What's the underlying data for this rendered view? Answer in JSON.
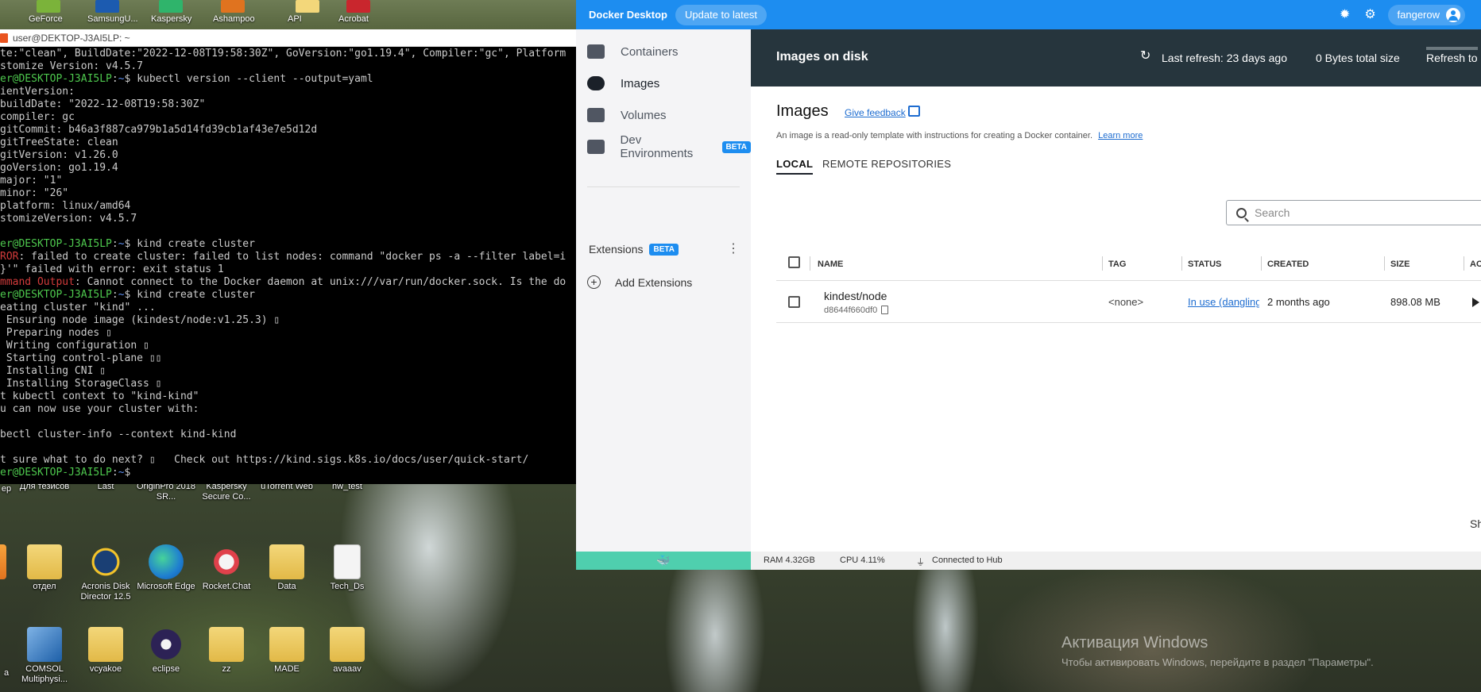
{
  "desktop": {
    "top_icons": [
      "GeForce",
      "SamsungU...",
      "Kaspersky",
      "Ashampoo",
      "API",
      "Acrobat"
    ],
    "icons_row1": [
      "Для тезисов",
      "Last",
      "OriginPro 2018 SR...",
      "Kaspersky Secure Co...",
      "uTorrent Web",
      "hw_test"
    ],
    "icons_row1_partial": "ер",
    "icons_row2": [
      "отдел",
      "Acronis Disk Director 12.5",
      "Microsoft Edge",
      "Rocket.Chat",
      "Data",
      "Tech_Ds"
    ],
    "icons_row3": [
      "COMSOL Multiphysi...",
      "vcyakoe",
      "eclipse",
      "zz",
      "MADE",
      "avaaav"
    ],
    "icons_row3_partial": "a",
    "watermark_title": "Активация Windows",
    "watermark_text": "Чтобы активировать Windows, перейдите в раздел \"Параметры\"."
  },
  "terminal": {
    "title": "user@DEKTOP-J3AI5LP: ~",
    "lines": [
      [
        {
          "t": "te:\"clean\", BuildDate:\"2022-12-08T19:58:30Z\", GoVersion:\"go1.19.4\", Compiler:\"gc\", Platform",
          "c": ""
        }
      ],
      [
        {
          "t": "stomize Version: v4.5.7",
          "c": ""
        }
      ],
      [
        {
          "t": "er@DESKTOP-J3AI5LP",
          "c": "g"
        },
        {
          "t": ":",
          "c": ""
        },
        {
          "t": "~",
          "c": "b"
        },
        {
          "t": "$ kubectl version --client --output=yaml",
          "c": ""
        }
      ],
      [
        {
          "t": "ientVersion:",
          "c": ""
        }
      ],
      [
        {
          "t": "buildDate: \"2022-12-08T19:58:30Z\"",
          "c": ""
        }
      ],
      [
        {
          "t": "compiler: gc",
          "c": ""
        }
      ],
      [
        {
          "t": "gitCommit: b46a3f887ca979b1a5d14fd39cb1af43e7e5d12d",
          "c": ""
        }
      ],
      [
        {
          "t": "gitTreeState: clean",
          "c": ""
        }
      ],
      [
        {
          "t": "gitVersion: v1.26.0",
          "c": ""
        }
      ],
      [
        {
          "t": "goVersion: go1.19.4",
          "c": ""
        }
      ],
      [
        {
          "t": "major: \"1\"",
          "c": ""
        }
      ],
      [
        {
          "t": "minor: \"26\"",
          "c": ""
        }
      ],
      [
        {
          "t": "platform: linux/amd64",
          "c": ""
        }
      ],
      [
        {
          "t": "stomizeVersion: v4.5.7",
          "c": ""
        }
      ],
      [
        {
          "t": "",
          "c": ""
        }
      ],
      [
        {
          "t": "er@DESKTOP-J3AI5LP",
          "c": "g"
        },
        {
          "t": ":",
          "c": ""
        },
        {
          "t": "~",
          "c": "b"
        },
        {
          "t": "$ kind create cluster",
          "c": ""
        }
      ],
      [
        {
          "t": "ROR",
          "c": "r"
        },
        {
          "t": ": failed to create cluster: failed to list nodes: command \"docker ps -a --filter label=i",
          "c": ""
        }
      ],
      [
        {
          "t": "}'\" failed with error: exit status 1",
          "c": ""
        }
      ],
      [
        {
          "t": "mmand Output",
          "c": "r"
        },
        {
          "t": ": Cannot connect to the Docker daemon at unix:///var/run/docker.sock. Is the do",
          "c": ""
        }
      ],
      [
        {
          "t": "er@DESKTOP-J3AI5LP",
          "c": "g"
        },
        {
          "t": ":",
          "c": ""
        },
        {
          "t": "~",
          "c": "b"
        },
        {
          "t": "$ kind create cluster",
          "c": ""
        }
      ],
      [
        {
          "t": "eating cluster \"kind\" ...",
          "c": ""
        }
      ],
      [
        {
          "t": " Ensuring node image (kindest/node:v1.25.3) ▯",
          "c": ""
        }
      ],
      [
        {
          "t": " Preparing nodes ▯",
          "c": ""
        }
      ],
      [
        {
          "t": " Writing configuration ▯",
          "c": ""
        }
      ],
      [
        {
          "t": " Starting control-plane ▯▯",
          "c": ""
        }
      ],
      [
        {
          "t": " Installing CNI ▯",
          "c": ""
        }
      ],
      [
        {
          "t": " Installing StorageClass ▯",
          "c": ""
        }
      ],
      [
        {
          "t": "t kubectl context to \"kind-kind\"",
          "c": ""
        }
      ],
      [
        {
          "t": "u can now use your cluster with:",
          "c": ""
        }
      ],
      [
        {
          "t": "",
          "c": ""
        }
      ],
      [
        {
          "t": "bectl cluster-info --context kind-kind",
          "c": ""
        }
      ],
      [
        {
          "t": "",
          "c": ""
        }
      ],
      [
        {
          "t": "t sure what to do next? ▯   Check out https://kind.sigs.k8s.io/docs/user/quick-start/",
          "c": ""
        }
      ],
      [
        {
          "t": "er@DESKTOP-J3AI5LP",
          "c": "g"
        },
        {
          "t": ":",
          "c": ""
        },
        {
          "t": "~",
          "c": "b"
        },
        {
          "t": "$",
          "c": ""
        }
      ]
    ]
  },
  "docker": {
    "app_title": "Docker Desktop",
    "update_label": "Update to latest",
    "user_name": "fangerow",
    "header_icons": [
      "bug-icon",
      "gear-icon"
    ],
    "nav": [
      {
        "label": "Containers",
        "icon": "containers-icon",
        "active": false
      },
      {
        "label": "Images",
        "icon": "cloud-icon",
        "active": true
      },
      {
        "label": "Volumes",
        "icon": "volumes-icon",
        "active": false
      },
      {
        "label": "Dev Environments",
        "icon": "dev-env-icon",
        "active": false,
        "badge": "BETA"
      }
    ],
    "extensions_label": "Extensions",
    "extensions_badge": "BETA",
    "add_extensions_label": "Add Extensions",
    "topbar": {
      "title": "Images on disk",
      "last_refresh": "Last refresh: 23 days ago",
      "total_size": "0 Bytes total size",
      "refresh_label": "Refresh to"
    },
    "images_title": "Images",
    "feedback_label": "Give feedback",
    "description": "An image is a read-only template with instructions for creating a Docker container.",
    "learn_more": "Learn more",
    "tabs": [
      "LOCAL",
      "REMOTE REPOSITORIES"
    ],
    "search_placeholder": "Search",
    "columns": [
      "NAME",
      "TAG",
      "STATUS",
      "CREATED",
      "SIZE",
      "ACTIO"
    ],
    "rows": [
      {
        "name": "kindest/node",
        "id": "d8644f660df0",
        "tag": "<none>",
        "status": "In use (dangling)",
        "created": "2 months ago",
        "size": "898.08 MB"
      }
    ],
    "bottom_right_text": "Sh",
    "footer": {
      "ram": "RAM 4.32GB",
      "cpu": "CPU 4.11%",
      "hub": "Connected to Hub"
    },
    "accent_color": "#1d8df0",
    "footer_color": "#4fcfae"
  }
}
